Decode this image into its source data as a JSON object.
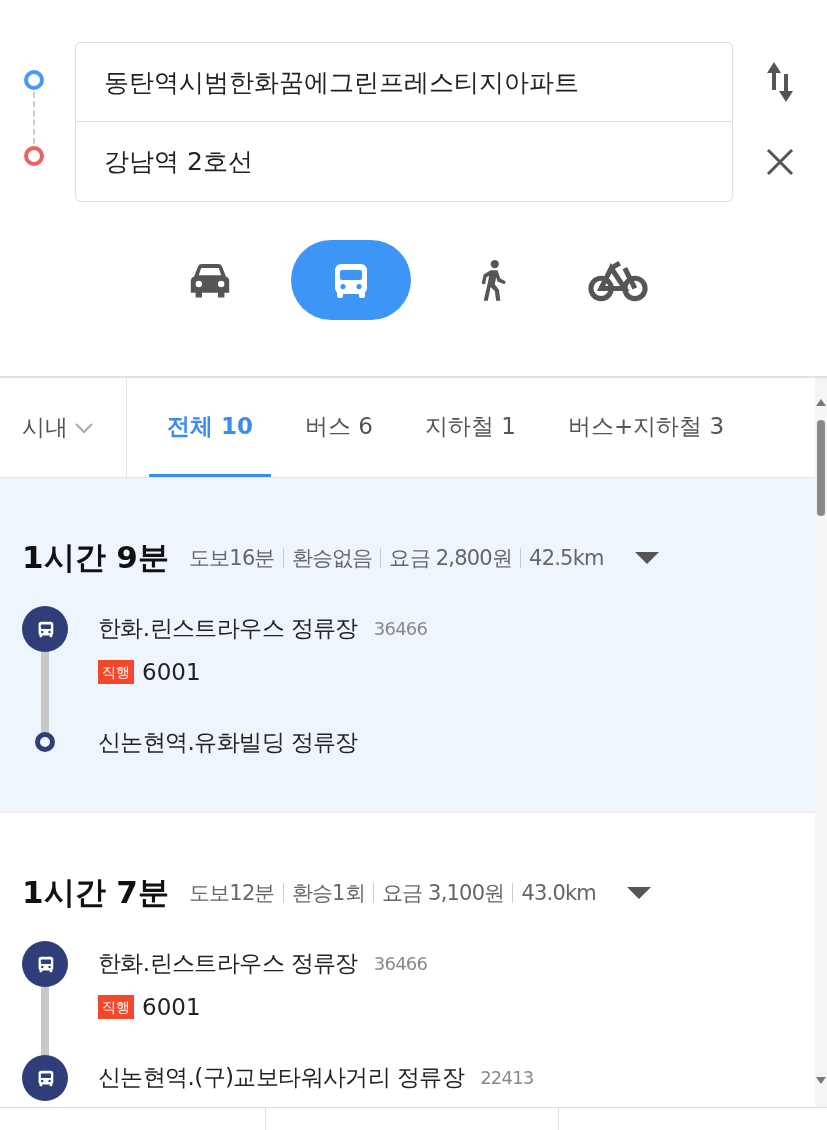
{
  "route_inputs": [
    {
      "kind": "origin",
      "value": "동탄역시범한화꿈에그린프레스티지아파트"
    },
    {
      "kind": "destination",
      "value": "강남역 2호선"
    }
  ],
  "modes": [
    {
      "kind": "car",
      "selected": false
    },
    {
      "kind": "bus",
      "selected": true
    },
    {
      "kind": "walk",
      "selected": false
    },
    {
      "kind": "bike",
      "selected": false
    }
  ],
  "region_filter": {
    "label": "시내"
  },
  "tabs": [
    {
      "label": "전체 10",
      "selected": true
    },
    {
      "label": "버스 6",
      "selected": false
    },
    {
      "label": "지하철 1",
      "selected": false
    },
    {
      "label": "버스+지하철 3",
      "selected": false
    }
  ],
  "routes": [
    {
      "selected": true,
      "duration": "1시간 9분",
      "details": [
        "도보16분",
        "환승없음",
        "요금 2,800원",
        "42.5km"
      ],
      "stops": [
        {
          "kind": "bus",
          "name": "한화.린스트라우스 정류장",
          "stop_id": "36466",
          "line": {
            "type": "직행",
            "number": "6001",
            "color": "#f2482b"
          }
        },
        {
          "kind": "end",
          "name": "신논현역.유화빌딩 정류장"
        }
      ]
    },
    {
      "selected": false,
      "duration": "1시간 7분",
      "details": [
        "도보12분",
        "환승1회",
        "요금 3,100원",
        "43.0km"
      ],
      "stops": [
        {
          "kind": "bus",
          "name": "한화.린스트라우스 정류장",
          "stop_id": "36466",
          "line": {
            "type": "직행",
            "number": "6001",
            "color": "#f2482b"
          }
        },
        {
          "kind": "bus",
          "name": "신논현역.(구)교보타워사거리 정류장",
          "stop_id": "22413"
        }
      ]
    }
  ]
}
